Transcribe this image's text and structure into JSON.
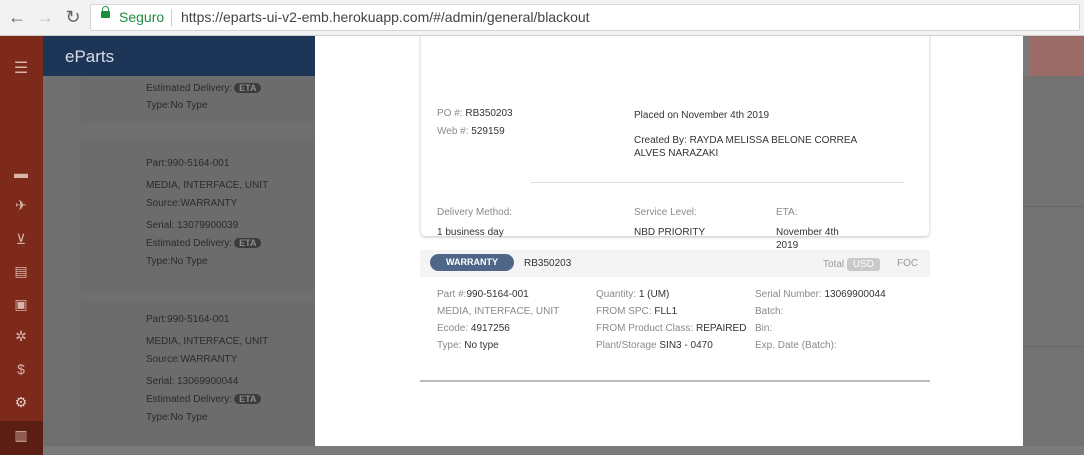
{
  "browser": {
    "secure_label": "Seguro",
    "url": "https://eparts-ui-v2-emb.herokuapp.com/#/admin/general/blackout"
  },
  "app": {
    "brand": "eParts"
  },
  "sidebar": {
    "icons": [
      "menu-icon",
      "truck-icon",
      "airplane-icon",
      "cart-icon",
      "document-icon",
      "calendar-icon",
      "parts-icon",
      "money-icon",
      "settings-icon",
      "chart-icon"
    ]
  },
  "background_list": {
    "card0": {
      "eta_label": "Estimated Delivery:",
      "eta_badge": "ETA",
      "type": "Type:No Type"
    },
    "card1": {
      "part": "Part:990-5164-001",
      "desc": "MEDIA, INTERFACE, UNIT",
      "source": "Source:WARRANTY",
      "serial": "Serial: 13079900039",
      "eta_label": "Estimated Delivery:",
      "eta_badge": "ETA",
      "type": "Type:No Type"
    },
    "card2": {
      "part": "Part:990-5164-001",
      "desc": "MEDIA, INTERFACE, UNIT",
      "source": "Source:WARRANTY",
      "serial": "Serial: 13069900044",
      "eta_label": "Estimated Delivery:",
      "eta_badge": "ETA",
      "type": "Type:No Type"
    }
  },
  "order": {
    "po_label": "PO #:",
    "po_value": "RB350203",
    "web_label": "Web #:",
    "web_value": "529159",
    "placed": "Placed on November 4th 2019",
    "created_by_1": "Created By: RAYDA MELISSA BELONE CORREA",
    "created_by_2": "ALVES NARAZAKI",
    "delivery_method_label": "Delivery Method:",
    "delivery_method_value": "1 business day",
    "service_level_label": "Service Level:",
    "service_level_value": "NBD PRIORITY",
    "eta_label": "ETA:",
    "eta_value_1": "November 4th",
    "eta_value_2": "2019"
  },
  "item": {
    "badge": "WARRANTY",
    "order_number": "RB350203",
    "total_label": "Total",
    "currency": "USD",
    "foc": "FOC",
    "part_label": "Part #:",
    "part_value": "990-5164-001",
    "desc": "MEDIA, INTERFACE, UNIT",
    "ecode_label": "Ecode:",
    "ecode_value": "4917256",
    "type_label": "Type:",
    "type_value": "No type",
    "quantity_label": "Quantity:",
    "quantity_value": "1 (UM)",
    "from_spc_label": "FROM SPC:",
    "from_spc_value": "FLL1",
    "product_class_label": "FROM Product Class:",
    "product_class_value": "REPAIRED",
    "plant_label": "Plant/Storage",
    "plant_value": "SIN3 - 0470",
    "serial_label": "Serial Number:",
    "serial_value": "13069900044",
    "batch_label": "Batch:",
    "bin_label": "Bin:",
    "exp_label": "Exp. Date (Batch):"
  }
}
